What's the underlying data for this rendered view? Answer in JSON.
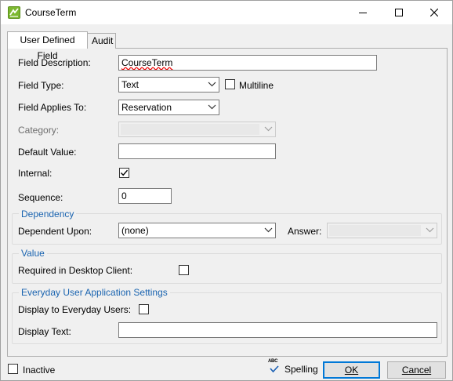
{
  "window": {
    "title": "CourseTerm",
    "controls": {
      "minimize": "minimize-icon",
      "maximize": "maximize-icon",
      "close": "close-icon"
    }
  },
  "tabs": [
    {
      "label": "User Defined Field",
      "active": true
    },
    {
      "label": "Audit",
      "active": false
    }
  ],
  "form": {
    "field_description": {
      "label": "Field Description:",
      "value": "CourseTerm"
    },
    "field_type": {
      "label": "Field Type:",
      "value": "Text",
      "multiline_label": "Multiline",
      "multiline_checked": false
    },
    "field_applies_to": {
      "label": "Field Applies To:",
      "value": "Reservation"
    },
    "category": {
      "label": "Category:",
      "value": ""
    },
    "default_value": {
      "label": "Default Value:",
      "value": ""
    },
    "internal": {
      "label": "Internal:",
      "checked": true
    },
    "sequence": {
      "label": "Sequence:",
      "value": "0"
    }
  },
  "dependency": {
    "title": "Dependency",
    "dependent_upon_label": "Dependent Upon:",
    "dependent_upon_value": "(none)",
    "answer_label": "Answer:",
    "answer_value": ""
  },
  "value_group": {
    "title": "Value",
    "required_label": "Required in Desktop Client:",
    "required_checked": false
  },
  "everyday": {
    "title": "Everyday User Application Settings",
    "display_label": "Display to Everyday Users:",
    "display_checked": false,
    "display_text_label": "Display Text:",
    "display_text_value": ""
  },
  "footer": {
    "inactive_label": "Inactive",
    "inactive_checked": false,
    "spelling_label": "Spelling",
    "spelling_icon_text": "ABC",
    "ok_label": "OK",
    "cancel_label": "Cancel"
  },
  "colors": {
    "accent": "#0078d7",
    "group_title": "#1a64b0",
    "app_icon": "#7cb82f"
  }
}
